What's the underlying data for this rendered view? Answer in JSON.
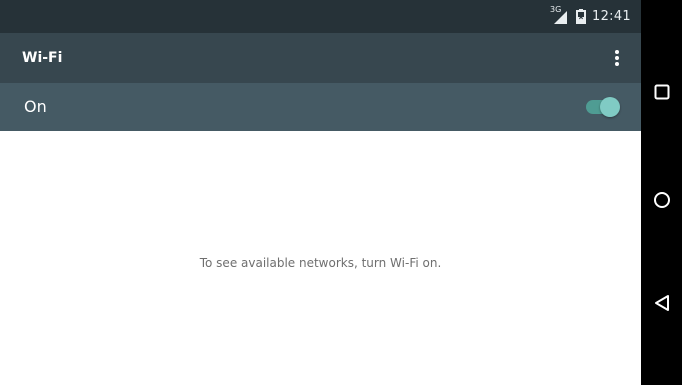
{
  "status_bar": {
    "network_type": "3G",
    "time": "12:41",
    "icons": [
      "signal-icon",
      "battery-icon"
    ]
  },
  "app_bar": {
    "title": "Wi-Fi",
    "menu_icon": "more-vert-icon"
  },
  "switch_bar": {
    "label": "On",
    "toggle_on": true
  },
  "content": {
    "message": "To see available networks, turn Wi-Fi on."
  },
  "nav_bar": {
    "icons": [
      "recents-icon",
      "home-icon",
      "back-icon"
    ]
  },
  "colors": {
    "status_bar": "#263238",
    "app_bar": "#37474f",
    "switch_bar": "#455a64",
    "toggle_accent": "#80cbc4",
    "nav_bar": "#000000"
  }
}
